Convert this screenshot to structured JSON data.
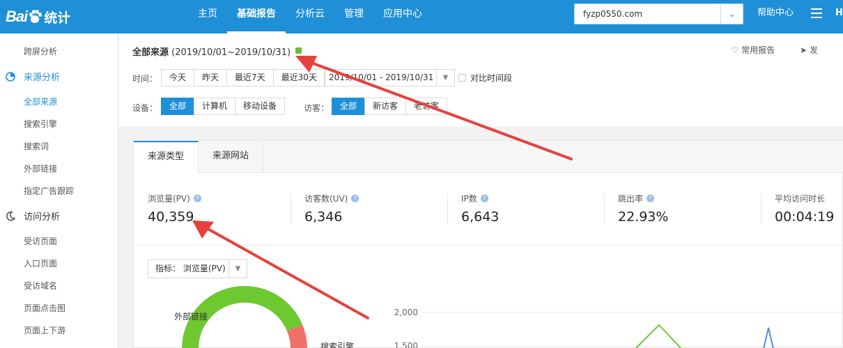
{
  "topbar": {
    "logo_text": "Bai",
    "logo_tongji": "统计",
    "nav": [
      "主页",
      "基础报告",
      "分析云",
      "管理",
      "应用中心"
    ],
    "active_nav": "基础报告",
    "site": "fyzp0550.com",
    "help": "帮助中心",
    "user": "H"
  },
  "sidebar": {
    "top_item": "跨屏分析",
    "group_source": "来源分析",
    "source_items": [
      "全部来源",
      "搜索引擎",
      "搜索词",
      "外部链接",
      "指定广告跟踪"
    ],
    "group_visit": "访问分析",
    "visit_items": [
      "受访页面",
      "入口页面",
      "受访域名",
      "页面点击图",
      "页面上下游"
    ]
  },
  "header": {
    "title": "全部来源",
    "date_range_title": "(2019/10/01~2019/10/31)",
    "fav_report": "常用报告",
    "send": "发",
    "time_label": "时间：",
    "time_buttons": [
      "今天",
      "昨天",
      "最近7天",
      "最近30天"
    ],
    "date_range": "2019/10/01 - 2019/10/31",
    "compare": "对比时间段",
    "device_label": "设备：",
    "device_buttons": [
      "全部",
      "计算机",
      "移动设备"
    ],
    "visitor_label": "访客：",
    "visitor_buttons": [
      "全部",
      "新访客",
      "老访客"
    ]
  },
  "tabs": [
    "来源类型",
    "来源网站"
  ],
  "metrics": [
    {
      "label": "浏览量(PV)",
      "value": "40,359"
    },
    {
      "label": "访客数(UV)",
      "value": "6,346"
    },
    {
      "label": "IP数",
      "value": "6,643"
    },
    {
      "label": "跳出率",
      "value": "22.93%"
    },
    {
      "label": "平均访问时长",
      "value": "00:04:19"
    }
  ],
  "indicator": {
    "label": "指标：",
    "value": "浏览量(PV)"
  },
  "chart_data": {
    "type": "line",
    "y_ticks": [
      "2,000",
      "1,500"
    ],
    "ylim": [
      1500,
      2000
    ],
    "donut_labels": [
      "外部链接",
      "搜索引擎"
    ]
  },
  "colors": {
    "accent": "#1f8fd8",
    "arrow": "#e8403c",
    "donut_green": "#6ec82f",
    "donut_red": "#f2706a"
  }
}
